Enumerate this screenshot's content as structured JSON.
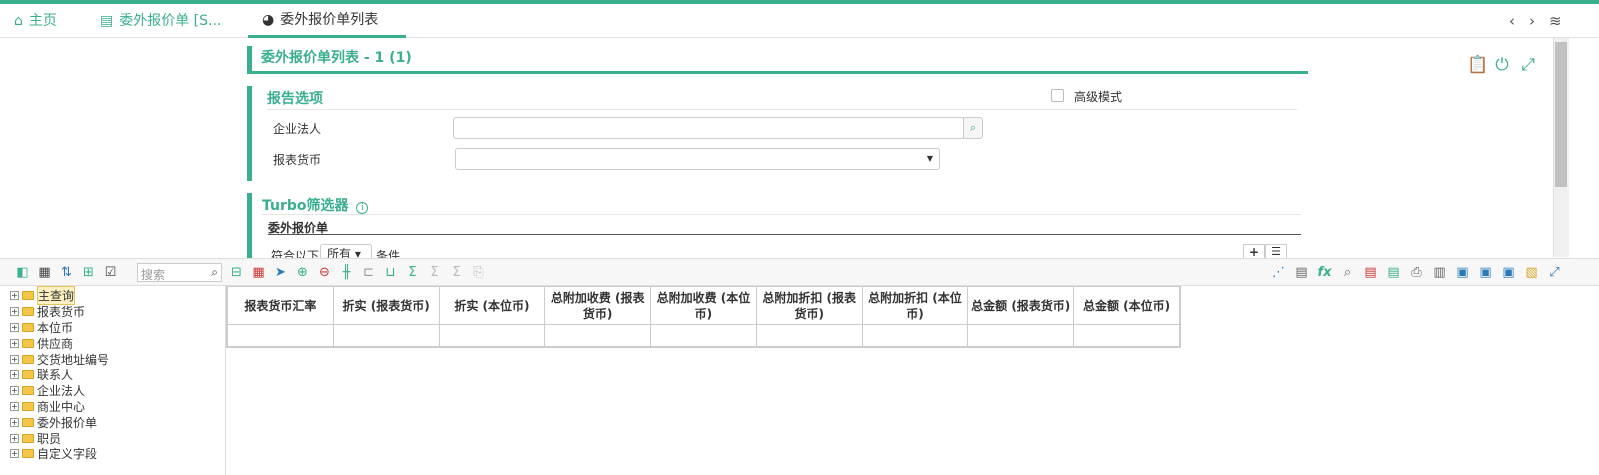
{
  "tabs": [
    {
      "label": "主页",
      "icon": "home-icon"
    },
    {
      "label": "委外报价单 [S...",
      "icon": "document-icon"
    },
    {
      "label": "委外报价单列表",
      "icon": "pie-chart-icon"
    }
  ],
  "page_title": "委外报价单列表 - 1 (1)",
  "report_options": {
    "title": "报告选项",
    "advanced_mode_label": "高级模式",
    "legal_entity_label": "企业法人",
    "legal_entity_value": "",
    "currency_label": "报表货币",
    "currency_value": ""
  },
  "turbo": {
    "title": "Turbo筛选器",
    "subtitle": "委外报价单",
    "match_prefix": "符合以下",
    "match_select": "所有",
    "match_suffix": "条件"
  },
  "toolbar": {
    "search_placeholder": "搜索"
  },
  "tree": [
    "主查询",
    "报表货币",
    "本位币",
    "供应商",
    "交货地址编号",
    "联系人",
    "企业法人",
    "商业中心",
    "委外报价单",
    "职员",
    "自定义字段"
  ],
  "grid": {
    "columns": [
      "报表货币汇率",
      "折实 (报表货币)",
      "折实 (本位币)",
      "总附加收费 (报表货币)",
      "总附加收费 (本位币)",
      "总附加折扣 (报表货币)",
      "总附加折扣 (本位币)",
      "总金额 (报表货币)",
      "总金额 (本位币)"
    ]
  },
  "colors": {
    "accent": "#3aaf8f"
  }
}
